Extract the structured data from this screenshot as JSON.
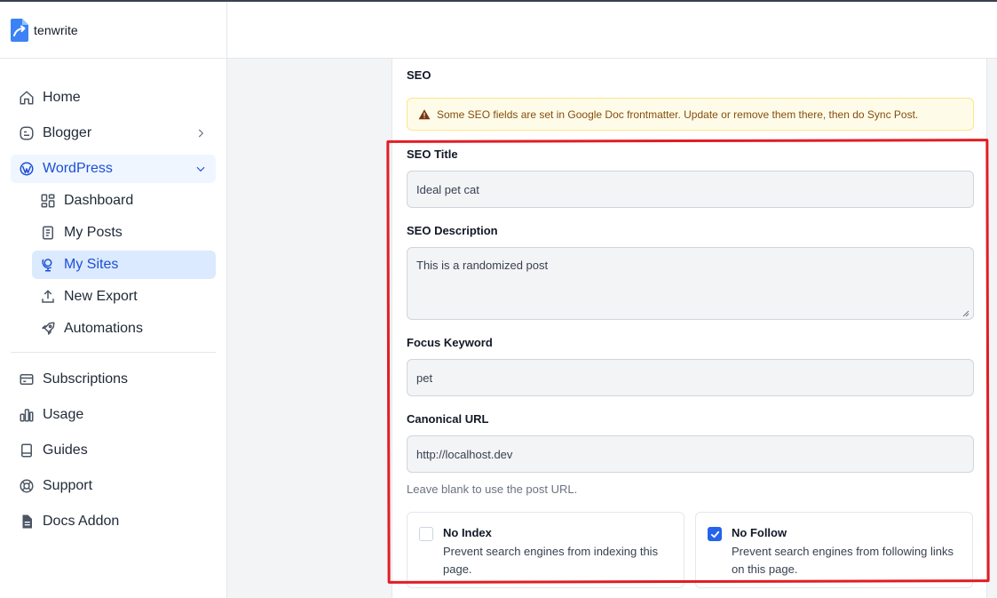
{
  "brand": {
    "name": "tenwrite"
  },
  "nav": {
    "home": "Home",
    "blogger": "Blogger",
    "wordpress": "WordPress",
    "dashboard": "Dashboard",
    "my_posts": "My Posts",
    "my_sites": "My Sites",
    "new_export": "New Export",
    "automations": "Automations",
    "subscriptions": "Subscriptions",
    "usage": "Usage",
    "guides": "Guides",
    "support": "Support",
    "docs_addon": "Docs Addon"
  },
  "seo": {
    "section_title": "SEO",
    "warning": "Some SEO fields are set in Google Doc frontmatter. Update or remove them there, then do Sync Post.",
    "title_label": "SEO Title",
    "title_value": "Ideal pet cat",
    "description_label": "SEO Description",
    "description_value": "This is a randomized post",
    "keyword_label": "Focus Keyword",
    "keyword_value": "pet",
    "canonical_label": "Canonical URL",
    "canonical_value": "http://localhost.dev",
    "canonical_hint": "Leave blank to use the post URL.",
    "no_index": {
      "title": "No Index",
      "description": "Prevent search engines from indexing this page.",
      "checked": false
    },
    "no_follow": {
      "title": "No Follow",
      "description": "Prevent search engines from following links on this page.",
      "checked": true
    }
  },
  "colors": {
    "accent": "#2563eb",
    "active_bg": "#dbeafe",
    "highlight": "#e11d24",
    "warning_bg": "#fefce8"
  }
}
